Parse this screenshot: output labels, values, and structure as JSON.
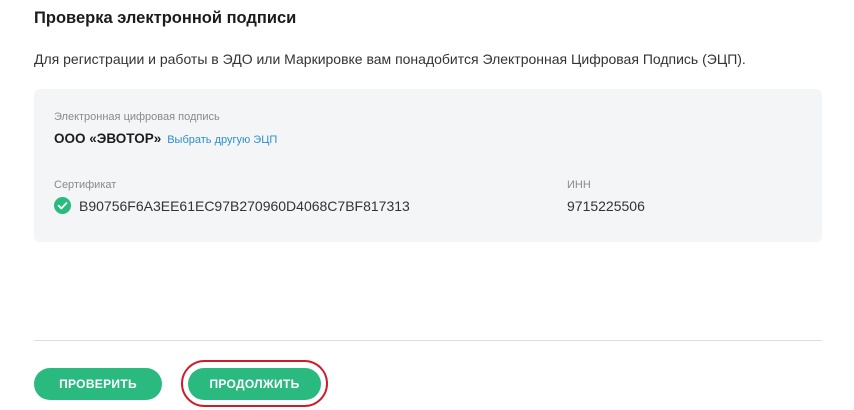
{
  "header": {
    "title": "Проверка электронной подписи"
  },
  "intro": {
    "text": "Для регистрации и работы в ЭДО или Маркировке вам понадобится Электронная Цифровая Подпись (ЭЦП)."
  },
  "signature_card": {
    "signature_label": "Электронная цифровая подпись",
    "organization": "ООО «ЭВОТОР»",
    "change_link": "Выбрать другую ЭЦП",
    "certificate_label": "Сертификат",
    "certificate_value": "B90756F6A3EE61EC97B270960D4068C7BF817313",
    "certificate_status_icon": "check-circle-icon",
    "inn_label": "ИНН",
    "inn_value": "9715225506"
  },
  "actions": {
    "check_button": "ПРОВЕРИТЬ",
    "continue_button": "ПРОДОЛЖИТЬ",
    "continue_highlighted": true
  },
  "colors": {
    "accent_green": "#2aba7f",
    "link_blue": "#2e8fc9",
    "highlight_red": "#c8202b",
    "card_background": "#f4f5f7"
  }
}
